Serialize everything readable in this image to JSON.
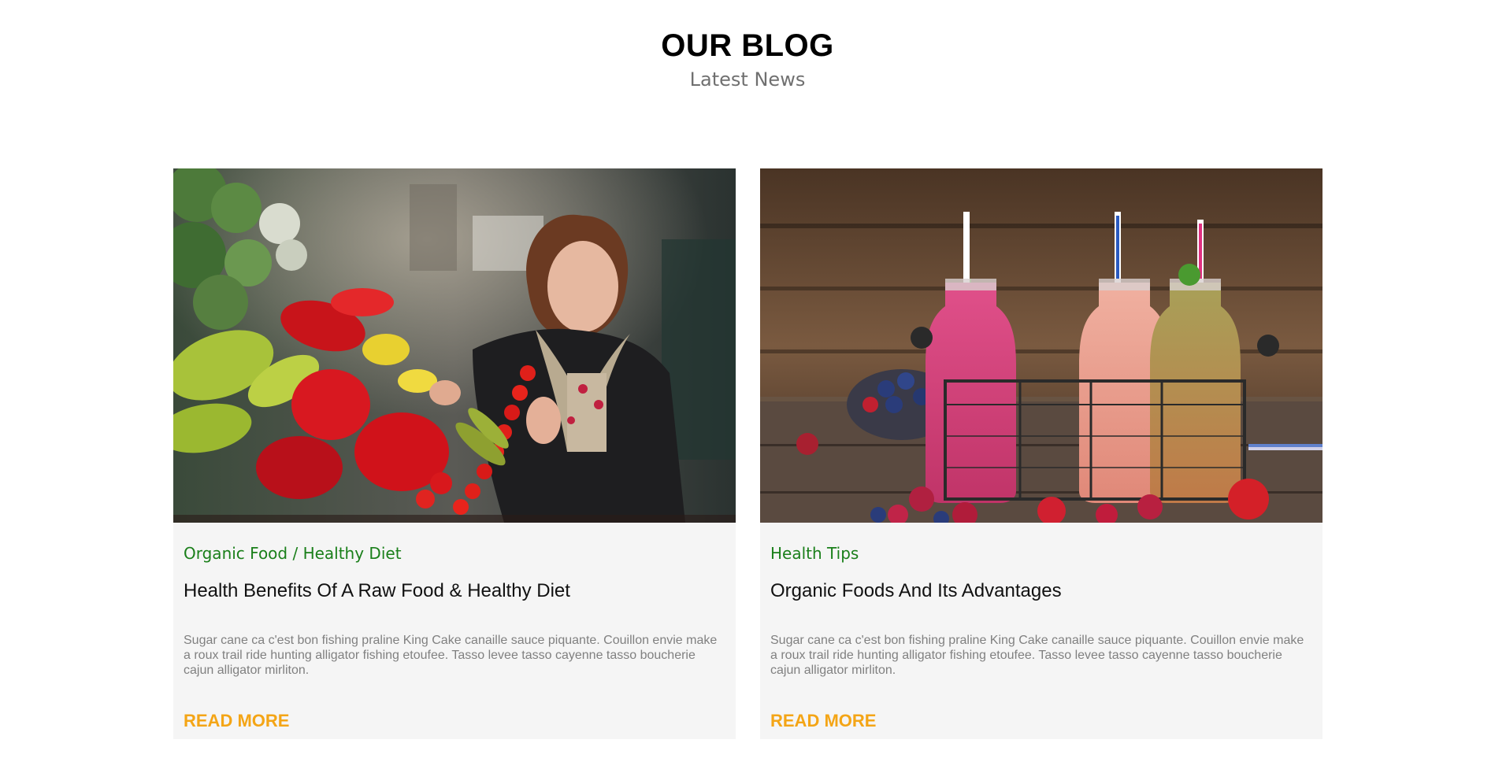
{
  "header": {
    "title": "OUR BLOG",
    "subtitle": "Latest News"
  },
  "posts": [
    {
      "image": "woman-shopping-vegetables-photo",
      "category": "Organic Food / Healthy Diet",
      "title": "Health Benefits Of A Raw Food & Healthy Diet",
      "excerpt": "Sugar cane ca c'est bon fishing praline King Cake canaille sauce piquante. Couillon envie make a roux trail ride hunting alligator fishing etoufee. Tasso levee tasso cayenne tasso boucherie cajun alligator mirliton.",
      "link_label": "READ MORE"
    },
    {
      "image": "smoothie-bottles-photo",
      "category": "Health Tips",
      "title": "Organic Foods And Its Advantages",
      "excerpt": "Sugar cane ca c'est bon fishing praline King Cake canaille sauce piquante. Couillon envie make a roux trail ride hunting alligator fishing etoufee. Tasso levee tasso cayenne tasso boucherie cajun alligator mirliton.",
      "link_label": "READ MORE"
    }
  ],
  "colors": {
    "category": "#1a7f1a",
    "link": "#f4a516",
    "card_background": "#f5f5f5",
    "excerpt": "#808080"
  }
}
